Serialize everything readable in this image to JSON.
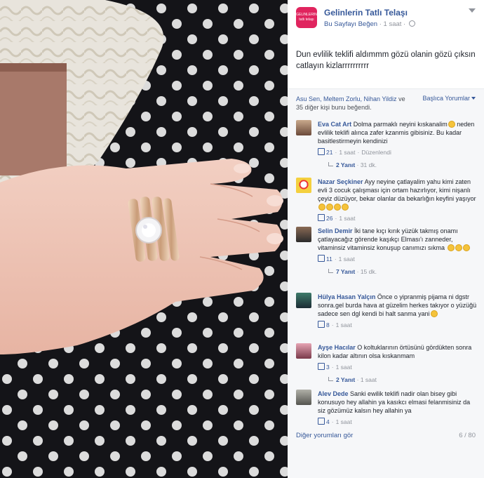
{
  "page": {
    "name": "Gelinlerin Tatlı Telaşı",
    "logo_text_top": "GELINLERIN",
    "logo_text_bottom": "tatlı telaşı",
    "like_label": "Bu Sayfayı Beğen",
    "time": "1 saat",
    "brand_color": "#e0245e"
  },
  "post": {
    "caption": "Dun evlilik teklifi aldımmm gözü olanin gözü çıksın catlayın kizlarrrrrrrrrr"
  },
  "likes": {
    "names": "Asu Sen, Meltem Zorlu, Nihan Yildiz",
    "rest": " ve 35 diğer kişi bunu beğendi.",
    "sort_label": "Başlıca Yorumlar"
  },
  "comments": [
    {
      "author": "Eva Cat Art",
      "text": "Dolma parmaklı neyini kıskanalim",
      "text2": " neden evlilik teklifi alınca zafer kzanmis gibisiniz. Bu kadar basitlestirmeyin kendinizi",
      "likes": "21",
      "time": "1 saat",
      "extra": "Düzenlendi",
      "replies": "2 Yanıt",
      "reply_time": "31 dk."
    },
    {
      "author": "Nazar Seçkiner",
      "text": "Ayy neyine çatlayalim yahu kimi zaten evli 3 cocuk çalışması için ortam hazırlıyor, kimi nişanlı çeyiz düzüyor, bekar olanlar da bekarlığın keyfini yaşıyor",
      "likes": "26",
      "time": "1 saat"
    },
    {
      "author": "Selin Demir",
      "text": "İki tane kıçı kırık yüzük takmış onamı çatlayacağız görende kaşıkçı Elması'ı zanneder, vitaminsiz vitaminsiz konuşup canımızı sıkma",
      "likes": "11",
      "time": "1 saat",
      "replies": "7 Yanıt",
      "reply_time": "15 dk."
    },
    {
      "author": "Hülya Hasan Yalçın",
      "text": "Önce o yipranmiş pijama ni dgstr sonra.gel burda hava at güzelim herkes takıyor o yüzüğü sadece sen dgl kendi bi halt sanma yani",
      "likes": "8",
      "time": "1 saat"
    },
    {
      "author": "Ayşe Hacılar",
      "text": "O koltuklarının örtüsünü gördükten sonra kilon kadar altının olsa kıskanmam",
      "likes": "3",
      "time": "1 saat",
      "replies": "2 Yanıt",
      "reply_time": "1 saat"
    },
    {
      "author": "Alev Dede",
      "text": "Sanki ewilik teklifi nadir olan bisey gibi konusuyo hey allahin ya kasıkcı elmasi felanmisiniz da siz gözümüz kalsın hey allahin ya",
      "likes": "4",
      "time": "1 saat"
    }
  ],
  "footer": {
    "more_label": "Diğer yorumları gör",
    "pager": "6 / 80"
  }
}
